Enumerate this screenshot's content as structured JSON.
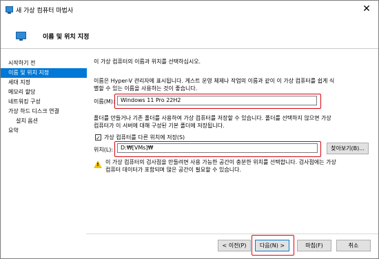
{
  "window": {
    "title": "새 가상 컴퓨터 마법사",
    "close_glyph": "✕"
  },
  "header": {
    "title": "이름 및 위치 지정"
  },
  "sidebar": {
    "items": [
      {
        "label": "시작하기 전"
      },
      {
        "label": "이름 및 위치 지정"
      },
      {
        "label": "세대 지정"
      },
      {
        "label": "메모리 할당"
      },
      {
        "label": "네트워킹 구성"
      },
      {
        "label": "가상 하드 디스크 연결"
      },
      {
        "label": "설치 옵션"
      },
      {
        "label": "요약"
      }
    ]
  },
  "content": {
    "intro": "이 가상 컴퓨터의 이름과 위치를 선택하십시오.",
    "name_help_line1": "이름은 Hyper-V 관리자에 표시됩니다. 게스트 운영 체제나 작업의 이름과 같이 이 가상 컴퓨터를 쉽게 식",
    "name_help_line2": "별할 수 있는 이름을 사용하는 것이 좋습니다.",
    "name_label": "이름(M):",
    "name_value": "Windows 11 Pro 22H2",
    "folder_help_line1": "폴더를 만들거나 기존 폴더를 사용하여 가상 컴퓨터를 저장할 수 있습니다. 폴더를 선택하지 않으면 가상",
    "folder_help_line2": "컴퓨터가 이 서버에 대해 구성된 기본 폴더에 저장됩니다.",
    "checkbox_label": "가상 컴퓨터를 다른 위치에 저장(S)",
    "checkbox_glyph": "✓",
    "location_label": "위치(L):",
    "location_value": "D:₩[VMs]₩",
    "browse_label": "찾아보기(B)...",
    "warning_line1": "이 가상 컴퓨터의 검사점을 만들려면 사용 가능한 공간이 충분한 위치를 선택합니다. 검사점에는 가상",
    "warning_line2": "컴퓨터 데이터가 포함되며 많은 공간이 필요할 수 있습니다."
  },
  "footer": {
    "prev_label": "< 이전(P)",
    "next_label": "다음(N) >",
    "finish_label": "마침(F)",
    "cancel_label": "취소"
  },
  "colors": {
    "accent": "#0078d7",
    "highlight_box": "#d9000d",
    "warning": "#f2c300"
  }
}
